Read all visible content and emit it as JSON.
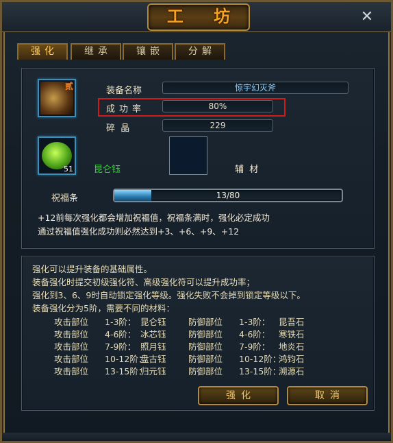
{
  "window": {
    "title": "工 坊",
    "close_glyph": "✕"
  },
  "tabs": [
    {
      "label": "强化",
      "active": true
    },
    {
      "label": "继承",
      "active": false
    },
    {
      "label": "镶嵌",
      "active": false
    },
    {
      "label": "分解",
      "active": false
    }
  ],
  "equipment": {
    "icon": "axe-icon",
    "badge": "贰",
    "name_label": "装备名称",
    "name_value": "惊宇幻灭斧",
    "rate_label": "成功率",
    "rate_value": "80%",
    "shard_label": "碎  晶",
    "shard_value": "229"
  },
  "material": {
    "icon": "kunlun-stone-icon",
    "count": "51",
    "name": "昆仑钰",
    "aux_label": "辅  材"
  },
  "bless": {
    "label": "祝福条",
    "value_text": "13/80",
    "fraction": 0.1625
  },
  "bless_desc": [
    "+12前每次强化都会增加祝福值，祝福条满时，强化必定成功",
    "通过祝福值强化成功则必然达到+3、+6、+9、+12"
  ],
  "info": [
    "强化可以提升装备的基础属性。",
    "装备强化时提交初级强化符、高级强化符可以提升成功率；",
    "强化到3、6、9时自动锁定强化等级。强化失败不会掉到锁定等级以下。",
    "装备强化分为5阶，需要不同的材料："
  ],
  "materials_table": [
    {
      "a_part": "攻击部位",
      "a_level": "1-3阶：",
      "a_mat": "昆仑钰",
      "d_part": "防御部位",
      "d_level": "1-3阶：",
      "d_mat": "昆吾石"
    },
    {
      "a_part": "攻击部位",
      "a_level": "4-6阶：",
      "a_mat": "冰芯钰",
      "d_part": "防御部位",
      "d_level": "4-6阶：",
      "d_mat": "寒铁石"
    },
    {
      "a_part": "攻击部位",
      "a_level": "7-9阶：",
      "a_mat": "照月钰",
      "d_part": "防御部位",
      "d_level": "7-9阶：",
      "d_mat": "地炎石"
    },
    {
      "a_part": "攻击部位",
      "a_level": "10-12阶：",
      "a_mat": "盘古钰",
      "d_part": "防御部位",
      "d_level": "10-12阶：",
      "d_mat": "鸿钧石"
    },
    {
      "a_part": "攻击部位",
      "a_level": "13-15阶：",
      "a_mat": "归元钰",
      "d_part": "防御部位",
      "d_level": "13-15阶：",
      "d_mat": "溯源石"
    }
  ],
  "buttons": {
    "confirm": "强化",
    "cancel": "取消"
  },
  "colors": {
    "accent": "#f4a324",
    "highlight": "#d21b1b",
    "green_text": "#3cd33c"
  }
}
